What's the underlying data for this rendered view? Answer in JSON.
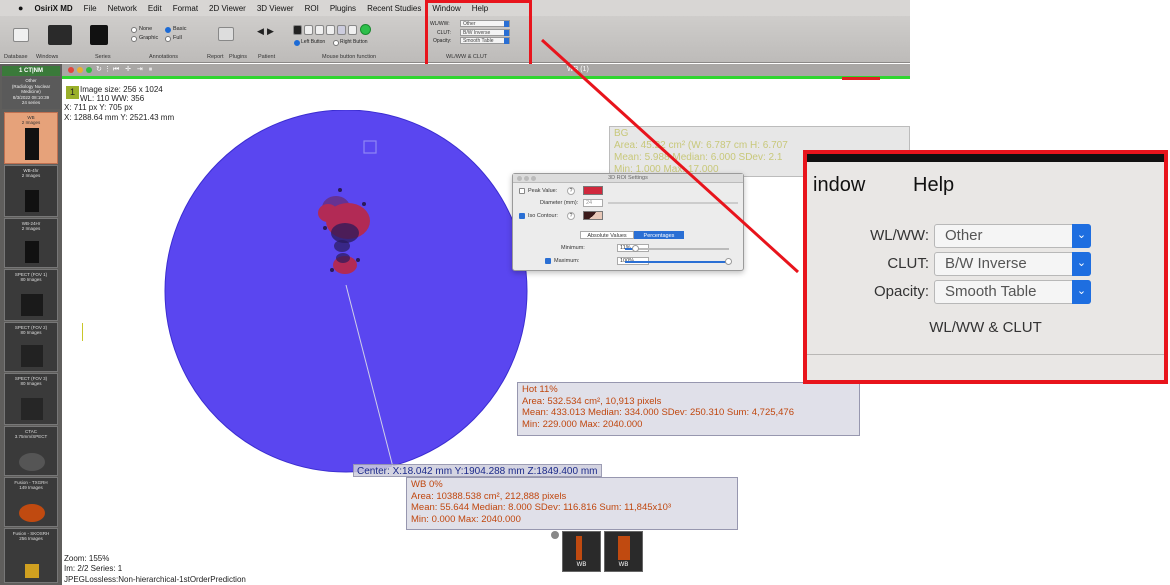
{
  "menubar": {
    "app": "OsiriX MD",
    "items": [
      "File",
      "Network",
      "Edit",
      "Format",
      "2D Viewer",
      "3D Viewer",
      "ROI",
      "Plugins",
      "Recent Studies",
      "Window",
      "Help"
    ]
  },
  "toolbar": {
    "section_labels": [
      "Database",
      "Windows",
      "Series",
      "Annotations",
      "Report",
      "Plugins",
      "Patient",
      "Mouse button function",
      "WL/WW & CLUT"
    ],
    "annotations": {
      "none": "None",
      "graphic": "Graphic",
      "basic": "Basic",
      "full": "Full"
    },
    "mouse_buttons": {
      "left": "Left Button",
      "right": "Right Button"
    },
    "wlww": {
      "wl_label": "WL/WW:",
      "wl_value": "Other",
      "clut_label": "CLUT:",
      "clut_value": "B/W Inverse",
      "opacity_label": "Opacity:",
      "opacity_value": "Smooth Table"
    }
  },
  "viewer": {
    "series_tab": "1 CT|NM",
    "window_title": "WB (1)",
    "study_info": {
      "line1": "Other",
      "line2": "(Radiology Nuclear",
      "line3": "Medicine)",
      "line4": "8/3/2022 08:10:39",
      "line5": "24 series"
    },
    "info_top": {
      "badge": "1",
      "image_size": "Image size: 256 x 1024",
      "wlww": "WL: 110 WW: 356",
      "px": "X: 711 px Y: 705 px",
      "mm": "X: 1288.64 mm Y: 2521.43 mm"
    },
    "info_bottom": {
      "zoom": "Zoom: 155%",
      "im": "Im: 2/2  Series: 1",
      "compression": "JPEGLossless:Non-hierarchical-1stOrderPrediction"
    }
  },
  "thumbnails": [
    {
      "name": "WB",
      "count": "2 Images"
    },
    {
      "name": "WB-4hr",
      "count": "2 Images"
    },
    {
      "name": "WB-24Hr",
      "count": "2 Images"
    },
    {
      "name": "SPECT (FOV 1)",
      "count": "80 Images"
    },
    {
      "name": "SPECT (FOV 2)",
      "count": "80 Images"
    },
    {
      "name": "SPECT (FOV 3)",
      "count": "80 Images"
    },
    {
      "name": "CTAC",
      "count": "3.75mm/SPECT"
    },
    {
      "name": "Fusion - TXGRH",
      "count": "149 Images"
    },
    {
      "name": "Fusion - SKOSRH",
      "count": "256 Images"
    }
  ],
  "roi_bg": {
    "name": "BG",
    "area": "Area: 45.22 cm² (W: 6.787 cm H: 6.707",
    "mean": "Mean: 5.988  Median: 6.000  SDev: 2.1",
    "min": "Min: 1.000  Max: 17.000"
  },
  "roi_hot": {
    "name": "Hot 11%",
    "area": "Area: 532.534 cm², 10,913 pixels",
    "mean": "Mean: 433.013  Median: 334.000  SDev: 250.310  Sum: 4,725,476",
    "min": "Min: 229.000  Max: 2040.000"
  },
  "roi_wb": {
    "center": "Center: X:18.042 mm Y:1904.288 mm Z:1849.400 mm",
    "name": "WB 0%",
    "area": "Area: 10388.538 cm², 212,888 pixels",
    "mean": "Mean: 55.644  Median: 8.000  SDev: 116.816  Sum: 11,845x10³",
    "min": "Min: 0.000  Max: 2040.000"
  },
  "roi_dialog": {
    "title": "3D ROI Settings",
    "peak_value": "Peak Value:",
    "diameter": "Diameter (mm):",
    "diameter_value": "24",
    "iso_contour": "Iso Contour:",
    "abs_values": "Absolute Values",
    "percentages": "Percentages",
    "minimum_label": "Minimum:",
    "minimum_value": "11%",
    "maximum_label": "Maximum:",
    "maximum_value": "100%",
    "minimum_level": 0.11,
    "maximum_level": 1.0
  },
  "callout": {
    "menu_window": "indow",
    "menu_help": "Help",
    "wl_label": "WL/WW:",
    "wl_value": "Other",
    "clut_label": "CLUT:",
    "clut_value": "B/W Inverse",
    "opacity_label": "Opacity:",
    "opacity_value": "Smooth Table",
    "footer": "WL/WW & CLUT"
  },
  "preview_labels": [
    "WB",
    "WB"
  ],
  "colors": {
    "phantom": "#5a46f0",
    "hot_roi": "#c0470f",
    "highlight": "#e8141c",
    "accent": "#2a6fd4",
    "active_line": "#2fd62f"
  }
}
